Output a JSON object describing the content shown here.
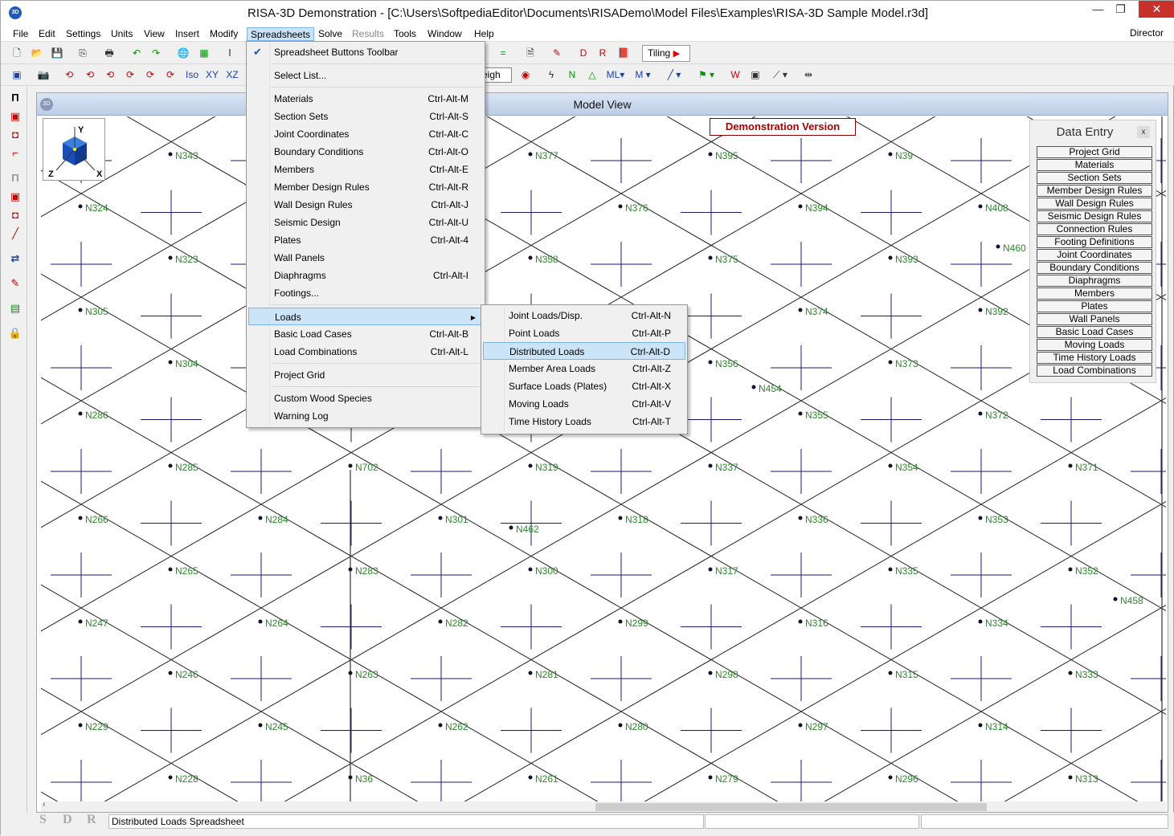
{
  "window": {
    "title": "RISA-3D Demonstration - [C:\\Users\\SoftpediaEditor\\Documents\\RISADemo\\Model Files\\Examples\\RISA-3D Sample Model.r3d]",
    "app_icon": "3D",
    "min": "—",
    "max": "❐",
    "close": "✕"
  },
  "menubar": {
    "items": [
      {
        "label": "File"
      },
      {
        "label": "Edit"
      },
      {
        "label": "Settings"
      },
      {
        "label": "Units"
      },
      {
        "label": "View"
      },
      {
        "label": "Insert"
      },
      {
        "label": "Modify"
      },
      {
        "label": "Spreadsheets",
        "active": true
      },
      {
        "label": "Solve"
      },
      {
        "label": "Results",
        "disabled": true
      },
      {
        "label": "Tools"
      },
      {
        "label": "Window"
      },
      {
        "label": "Help"
      }
    ],
    "right": "Director"
  },
  "toolbar": {
    "tiling": "Tiling",
    "weight": "eigh"
  },
  "mdi": {
    "title": "Model View",
    "icon": "3D",
    "demo": "Demonstration Version"
  },
  "axes": {
    "y": "Y",
    "z": "Z",
    "x": "X"
  },
  "data_entry": {
    "title": "Data Entry",
    "close": "x",
    "buttons": [
      "Project Grid",
      "Materials",
      "Section Sets",
      "Member Design Rules",
      "Wall Design Rules",
      "Seismic Design Rules",
      "Connection Rules",
      "Footing Definitions",
      "Joint Coordinates",
      "Boundary Conditions",
      "Diaphragms",
      "Members",
      "Plates",
      "Wall Panels",
      "Basic Load Cases",
      "Moving Loads",
      "Time History Loads",
      "Load Combinations"
    ]
  },
  "spreadsheets_menu": {
    "items": [
      {
        "label": "Spreadsheet Buttons Toolbar",
        "shortcut": "",
        "checked": true
      },
      {
        "sep": true
      },
      {
        "label": "Select List...",
        "shortcut": ""
      },
      {
        "sep": true
      },
      {
        "label": "Materials",
        "shortcut": "Ctrl-Alt-M"
      },
      {
        "label": "Section Sets",
        "shortcut": "Ctrl-Alt-S"
      },
      {
        "label": "Joint Coordinates",
        "shortcut": "Ctrl-Alt-C"
      },
      {
        "label": "Boundary Conditions",
        "shortcut": "Ctrl-Alt-O"
      },
      {
        "label": "Members",
        "shortcut": "Ctrl-Alt-E"
      },
      {
        "label": "Member Design Rules",
        "shortcut": "Ctrl-Alt-R"
      },
      {
        "label": "Wall Design Rules",
        "shortcut": "Ctrl-Alt-J"
      },
      {
        "label": "Seismic Design",
        "shortcut": "Ctrl-Alt-U"
      },
      {
        "label": "Plates",
        "shortcut": "Ctrl-Alt-4"
      },
      {
        "label": "Wall Panels",
        "shortcut": ""
      },
      {
        "label": "Diaphragms",
        "shortcut": "Ctrl-Alt-I"
      },
      {
        "label": "Footings...",
        "shortcut": ""
      },
      {
        "sep": true
      },
      {
        "label": "Loads",
        "shortcut": "",
        "submenu": true,
        "highlight": true
      },
      {
        "label": "Basic Load Cases",
        "shortcut": "Ctrl-Alt-B"
      },
      {
        "label": "Load Combinations",
        "shortcut": "Ctrl-Alt-L"
      },
      {
        "sep": true
      },
      {
        "label": "Project Grid",
        "shortcut": ""
      },
      {
        "sep": true
      },
      {
        "label": "Custom Wood Species",
        "shortcut": ""
      },
      {
        "label": "Warning Log",
        "shortcut": ""
      }
    ]
  },
  "loads_submenu": {
    "items": [
      {
        "label": "Joint Loads/Disp.",
        "shortcut": "Ctrl-Alt-N"
      },
      {
        "label": "Point Loads",
        "shortcut": "Ctrl-Alt-P"
      },
      {
        "label": "Distributed Loads",
        "shortcut": "Ctrl-Alt-D",
        "highlight": true
      },
      {
        "label": "Member Area Loads",
        "shortcut": "Ctrl-Alt-Z"
      },
      {
        "label": "Surface Loads (Plates)",
        "shortcut": "Ctrl-Alt-X"
      },
      {
        "label": "Moving Loads",
        "shortcut": "Ctrl-Alt-V"
      },
      {
        "label": "Time History Loads",
        "shortcut": "Ctrl-Alt-T"
      }
    ]
  },
  "model_nodes": [
    {
      "label": "N343"
    },
    {
      "label": "N377"
    },
    {
      "label": "N395"
    },
    {
      "label": "N39"
    },
    {
      "label": "N324"
    },
    {
      "label": "N376"
    },
    {
      "label": "N394"
    },
    {
      "label": "N408"
    },
    {
      "label": "N323"
    },
    {
      "label": "N358"
    },
    {
      "label": "N375"
    },
    {
      "label": "N393"
    },
    {
      "label": "N460"
    },
    {
      "label": "N305"
    },
    {
      "label": "N374"
    },
    {
      "label": "N392"
    },
    {
      "label": "N304"
    },
    {
      "label": "N356"
    },
    {
      "label": "N373"
    },
    {
      "label": "N454"
    },
    {
      "label": "N286"
    },
    {
      "label": "N355"
    },
    {
      "label": "N372"
    },
    {
      "label": "N285"
    },
    {
      "label": "N702"
    },
    {
      "label": "N319"
    },
    {
      "label": "N337"
    },
    {
      "label": "N354"
    },
    {
      "label": "N371"
    },
    {
      "label": "N266"
    },
    {
      "label": "N284"
    },
    {
      "label": "N301"
    },
    {
      "label": "N318"
    },
    {
      "label": "N336"
    },
    {
      "label": "N353"
    },
    {
      "label": "N462"
    },
    {
      "label": "N265"
    },
    {
      "label": "N283"
    },
    {
      "label": "N300"
    },
    {
      "label": "N317"
    },
    {
      "label": "N335"
    },
    {
      "label": "N352"
    },
    {
      "label": "N247"
    },
    {
      "label": "N264"
    },
    {
      "label": "N282"
    },
    {
      "label": "N299"
    },
    {
      "label": "N316"
    },
    {
      "label": "N334"
    },
    {
      "label": "N458"
    },
    {
      "label": "N246"
    },
    {
      "label": "N263"
    },
    {
      "label": "N281"
    },
    {
      "label": "N298"
    },
    {
      "label": "N315"
    },
    {
      "label": "N333"
    },
    {
      "label": "N229"
    },
    {
      "label": "N245"
    },
    {
      "label": "N262"
    },
    {
      "label": "N280"
    },
    {
      "label": "N297"
    },
    {
      "label": "N314"
    },
    {
      "label": "N228"
    },
    {
      "label": "N36"
    },
    {
      "label": "N261"
    },
    {
      "label": "N279"
    },
    {
      "label": "N296"
    },
    {
      "label": "N313"
    }
  ],
  "statusbar": {
    "s": "S",
    "d": "D",
    "r": "R",
    "text": "Distributed Loads Spreadsheet"
  },
  "colors": {
    "grid_line": "#1a1a6e",
    "node_label": "#2a8a2a",
    "highlight": "#cce4f7",
    "close_red": "#c7302b"
  }
}
